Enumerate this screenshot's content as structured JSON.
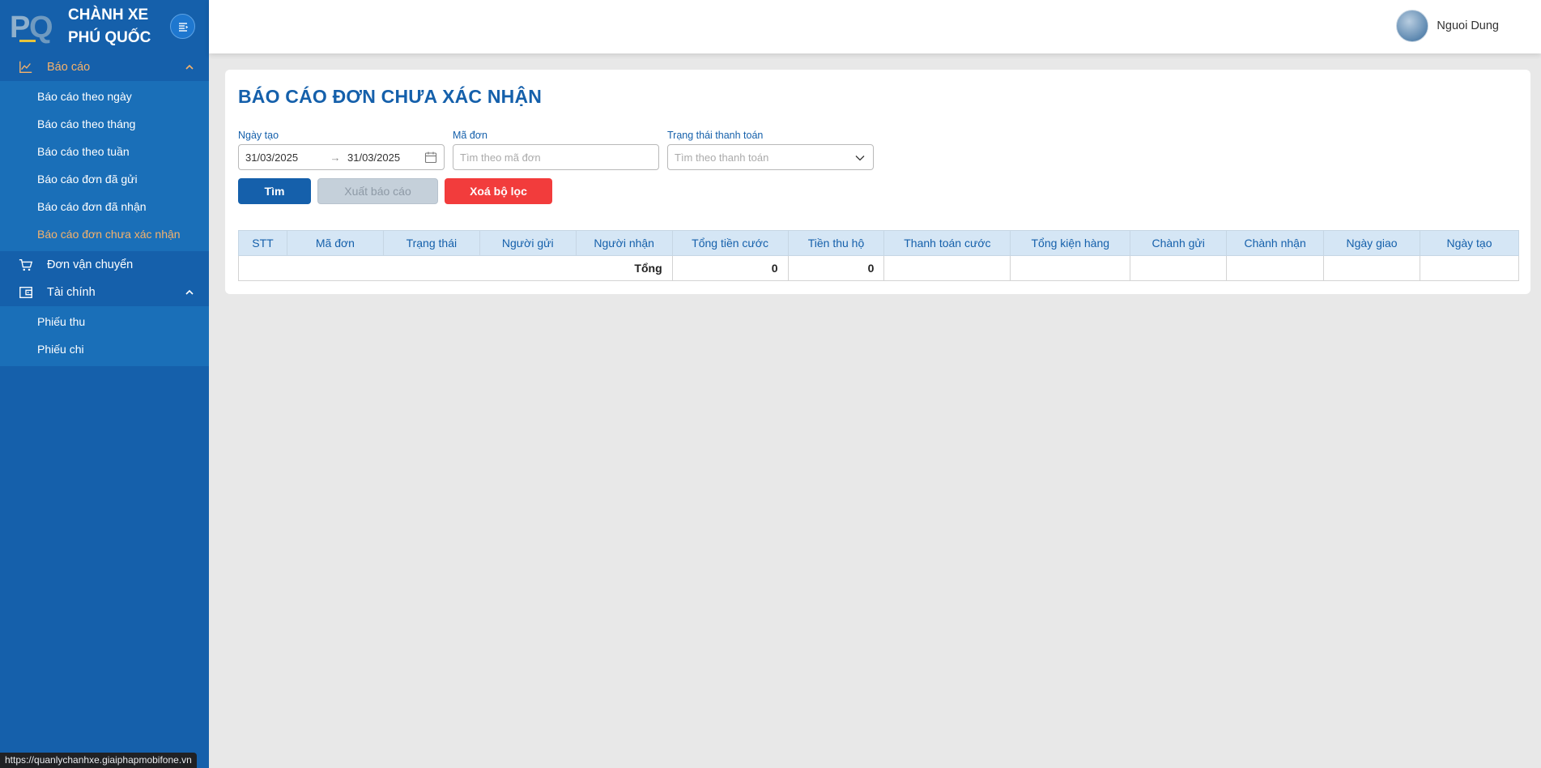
{
  "brand": {
    "line1": "CHÀNH XE",
    "line2": "PHÚ QUỐC",
    "logo_p": "P",
    "logo_q": "Q"
  },
  "sidebar": {
    "groups": [
      {
        "label": "Báo cáo",
        "icon": "chart-line-icon",
        "items": [
          {
            "label": "Báo cáo theo ngày"
          },
          {
            "label": "Báo cáo theo tháng"
          },
          {
            "label": "Báo cáo theo tuần"
          },
          {
            "label": "Báo cáo đơn đã gửi"
          },
          {
            "label": "Báo cáo đơn đã nhận"
          },
          {
            "label": "Báo cáo đơn chưa xác nhận"
          }
        ]
      },
      {
        "label": "Đơn vận chuyển",
        "icon": "cart-icon"
      },
      {
        "label": "Tài chính",
        "icon": "wallet-icon",
        "items": [
          {
            "label": "Phiếu thu"
          },
          {
            "label": "Phiếu chi"
          }
        ]
      }
    ],
    "active_color": "#f6b26b"
  },
  "header": {
    "user_name": "Nguoi Dung"
  },
  "page": {
    "title": "BÁO CÁO ĐƠN CHƯA XÁC NHẬN",
    "filters": {
      "date_label": "Ngày tạo",
      "date_from": "31/03/2025",
      "date_to": "31/03/2025",
      "code_label": "Mã đơn",
      "code_placeholder": "Tìm theo mã đơn",
      "pay_label": "Trạng thái thanh toán",
      "pay_placeholder": "Tìm theo thanh toán"
    },
    "buttons": {
      "search": "Tìm",
      "export": "Xuất báo cáo",
      "clear": "Xoá bộ lọc"
    },
    "table": {
      "columns": [
        "STT",
        "Mã đơn",
        "Trạng thái",
        "Người gửi",
        "Người nhận",
        "Tổng tiền cước",
        "Tiền thu hộ",
        "Thanh toán cước",
        "Tổng kiện hàng",
        "Chành gửi",
        "Chành nhận",
        "Ngày giao",
        "Ngày tạo"
      ],
      "total_label": "Tổng",
      "total_freight": "0",
      "total_cod": "0"
    }
  },
  "status_bar": {
    "url": "https://quanlychanhxe.giaiphapmobifone.vn"
  },
  "colors": {
    "primary": "#1560ab",
    "danger": "#f23c3c",
    "table_header_bg": "#d5e6f5"
  }
}
